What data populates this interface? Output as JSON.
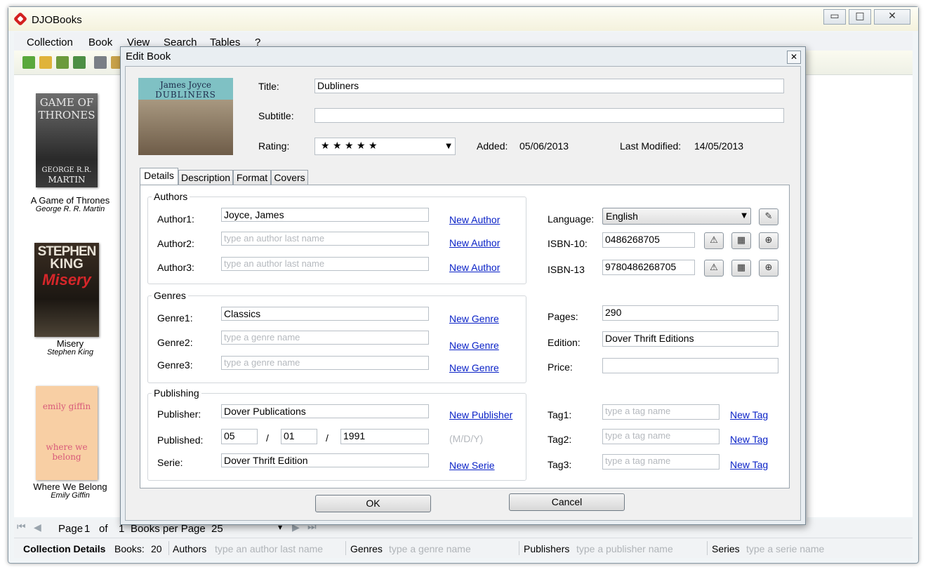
{
  "app": {
    "title": "DJOBooks"
  },
  "window_controls": {
    "minimize": "▭",
    "maximize": "□",
    "close": "✕"
  },
  "menu": {
    "items": [
      "Collection",
      "Book",
      "View",
      "Search",
      "Tables",
      "?"
    ]
  },
  "library": {
    "books": [
      {
        "title": "A Game of Thrones",
        "author": "George R. R. Martin",
        "cover_text_1": "GAME OF",
        "cover_text_2": "THRONES",
        "cover_text_3": "GEORGE R.R.",
        "cover_text_4": "MARTIN"
      },
      {
        "title": "Misery",
        "author": "Stephen King",
        "cover_text_1": "STEPHEN",
        "cover_text_2": "KING",
        "cover_text_3": "Misery"
      },
      {
        "title": "Where We Belong",
        "author": "Emily Giffin",
        "cover_text_1": "emily giffin",
        "cover_text_2": "where we",
        "cover_text_3": "belong"
      }
    ]
  },
  "pager": {
    "page_label": "Page",
    "page": "1",
    "of_label": "of",
    "total": "1",
    "per_page_label": "Books per Page",
    "per_page": "25"
  },
  "statusbar": {
    "collection_details": "Collection Details",
    "books_label": "Books:",
    "books_count": "20",
    "authors_label": "Authors",
    "authors_placeholder": "type an author last name",
    "genres_label": "Genres",
    "genres_placeholder": "type a genre name",
    "publishers_label": "Publishers",
    "publishers_placeholder": "type a publisher name",
    "series_label": "Series",
    "series_placeholder": "type a serie name"
  },
  "dialog": {
    "title": "Edit Book",
    "close": "✕",
    "cover": {
      "line1": "James Joyce",
      "line2": "DUBLINERS"
    },
    "title_label": "Title:",
    "title_value": "Dubliners",
    "subtitle_label": "Subtitle:",
    "subtitle_value": "",
    "rating_label": "Rating:",
    "rating_value": "★ ★ ★ ★ ★",
    "added_label": "Added:",
    "added_value": "05/06/2013",
    "modified_label": "Last Modified:",
    "modified_value": "14/05/2013",
    "tabs": [
      "Details",
      "Description",
      "Format",
      "Covers"
    ],
    "authors": {
      "group_title": "Authors",
      "rows": [
        {
          "label": "Author1:",
          "value": "Joyce, James",
          "placeholder": "",
          "link": "New Author"
        },
        {
          "label": "Author2:",
          "value": "",
          "placeholder": "type an author last name",
          "link": "New Author"
        },
        {
          "label": "Author3:",
          "value": "",
          "placeholder": "type an author last name",
          "link": "New Author"
        }
      ]
    },
    "genres": {
      "group_title": "Genres",
      "rows": [
        {
          "label": "Genre1:",
          "value": "Classics",
          "placeholder": "",
          "link": "New Genre"
        },
        {
          "label": "Genre2:",
          "value": "",
          "placeholder": "type a genre name",
          "link": "New Genre"
        },
        {
          "label": "Genre3:",
          "value": "",
          "placeholder": "type a genre name",
          "link": "New Genre"
        }
      ]
    },
    "publishing": {
      "group_title": "Publishing",
      "publisher_label": "Publisher:",
      "publisher_value": "Dover Publications",
      "publisher_link": "New Publisher",
      "published_label": "Published:",
      "month": "05",
      "day": "01",
      "year": "1991",
      "slash": "/",
      "date_hint": "(M/D/Y)",
      "serie_label": "Serie:",
      "serie_value": "Dover Thrift Edition",
      "serie_link": "New Serie"
    },
    "language_label": "Language:",
    "language_value": "English",
    "isbn10_label": "ISBN-10:",
    "isbn10_value": "0486268705",
    "isbn13_label": "ISBN-13",
    "isbn13_value": "9780486268705",
    "pages_label": "Pages:",
    "pages_value": "290",
    "edition_label": "Edition:",
    "edition_value": "Dover Thrift Editions",
    "price_label": "Price:",
    "price_value": "",
    "tags": [
      {
        "label": "Tag1:",
        "placeholder": "type a tag name",
        "link": "New Tag"
      },
      {
        "label": "Tag2:",
        "placeholder": "type a tag name",
        "link": "New Tag"
      },
      {
        "label": "Tag3:",
        "placeholder": "type a tag name",
        "link": "New Tag"
      }
    ],
    "ok_label": "OK",
    "cancel_label": "Cancel"
  },
  "icons": {
    "warning": "⚠",
    "calculator": "▦",
    "download": "⊕",
    "edit": "✎",
    "dropdown": "▼",
    "first_page": "⏮",
    "prev_page": "◀",
    "next_page": "▶",
    "last_page": "⏭"
  }
}
